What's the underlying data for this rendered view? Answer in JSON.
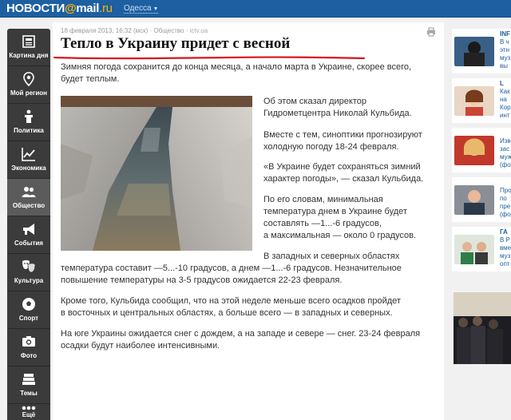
{
  "header": {
    "logo_main": "НОВОСТИ",
    "logo_at": "@",
    "logo_mail": "mail",
    "logo_ru": ".ru",
    "city": "Одесса"
  },
  "sidebar": {
    "items": [
      {
        "label": "Картина дня",
        "icon": "newspaper-icon"
      },
      {
        "label": "Мой регион",
        "icon": "map-pin-icon"
      },
      {
        "label": "Политика",
        "icon": "podium-icon"
      },
      {
        "label": "Экономика",
        "icon": "chart-icon"
      },
      {
        "label": "Общество",
        "icon": "people-icon"
      },
      {
        "label": "События",
        "icon": "megaphone-icon"
      },
      {
        "label": "Культура",
        "icon": "masks-icon"
      },
      {
        "label": "Спорт",
        "icon": "ball-icon"
      },
      {
        "label": "Фото",
        "icon": "camera-icon"
      },
      {
        "label": "Темы",
        "icon": "stack-icon"
      },
      {
        "label": "Ещё",
        "icon": "more-icon"
      }
    ],
    "active_index": 4
  },
  "article": {
    "date": "18 февраля 2013, 16:32 (мск)",
    "section": "Общество",
    "source": "ictv.ua",
    "title": "Тепло в Украину придет с весной",
    "lead_1": "Зимняя погода сохранится до конца месяца, а начало марта в Украине, скорее всего,",
    "lead_2": "будет теплым.",
    "col_p1_1": "Об этом сказал директор",
    "col_p1_2": "Гидрометцентра Николай Кульбида.",
    "col_p2_1": "Вместе с тем, синоптики прогнозируют",
    "col_p2_2": "холодную погоду 18-24 февраля.",
    "col_p3_1": "«В Украине будет сохраняться зимний",
    "col_p3_2": "характер погоды», — сказал Кульбида.",
    "col_p4_1": "По его словам, минимальная",
    "col_p4_2": "температура днем в Украине будет",
    "col_p4_3": "составлять —1...-6 градусов,",
    "col_p4_4": "а максимальная — около 0 градусов.",
    "col_p5_1": "В западных и северных областях",
    "wide_p5_2": "температура составит —5...-10 градусов, а днем —1...-6 градусов. Незначительное",
    "wide_p5_3": "повышение температуры на 3-5 градусов ожидается 22-23 февраля.",
    "wide_p6_1": "Кроме того, Кульбида сообщил, что на этой неделе меньше всего осадков пройдет",
    "wide_p6_2": "в восточных и центральных областях, а больше всего — в западных и северных.",
    "wide_p7_1": "На юге Украины ожидается снег с дождем, а на западе и севере — снег. 23-24 февраля",
    "wide_p7_2": "осадки будут наиболее интенсивными."
  },
  "right_news": [
    {
      "heading": "INF",
      "lines": [
        "В ч",
        "этн",
        "муз",
        "вы"
      ]
    },
    {
      "heading": "L",
      "lines": [
        "Как",
        "на",
        "Кор",
        "инт"
      ]
    },
    {
      "heading": "",
      "lines": [
        "Изв",
        "зас",
        "муж",
        "(фо"
      ]
    },
    {
      "heading": "",
      "lines": [
        "Про",
        "по",
        "пре",
        "(фо"
      ]
    },
    {
      "heading": "ГА",
      "lines": [
        "В Р",
        "вме",
        "муз",
        "опт"
      ]
    }
  ]
}
